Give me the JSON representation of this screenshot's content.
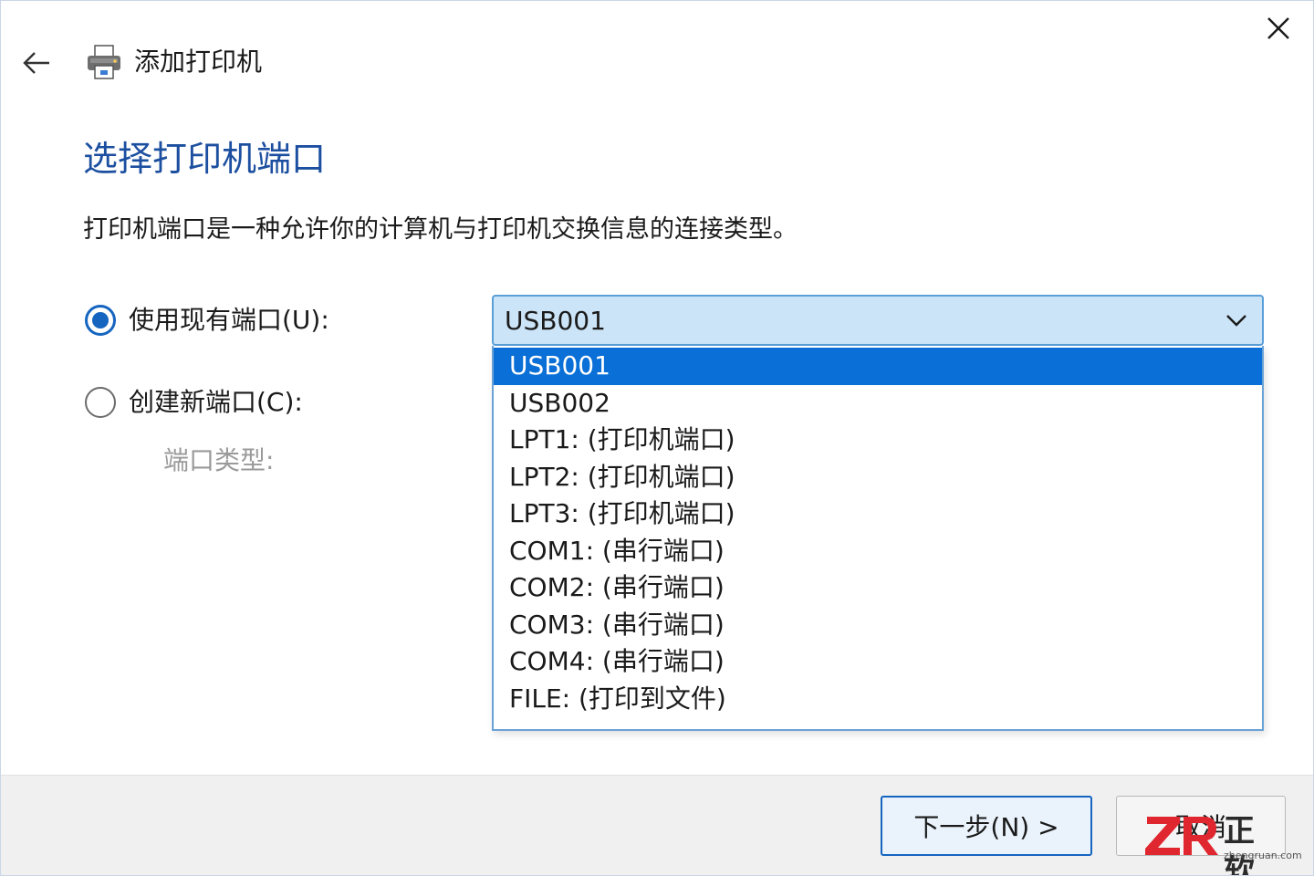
{
  "window": {
    "title": "添加打印机",
    "close_icon": "close-icon",
    "back_icon": "back-arrow-icon",
    "app_icon": "printer-icon"
  },
  "page": {
    "heading": "选择打印机端口",
    "description": "打印机端口是一种允许你的计算机与打印机交换信息的连接类型。"
  },
  "options": {
    "use_existing": {
      "label": "使用现有端口(U):",
      "checked": true
    },
    "create_new": {
      "label": "创建新端口(C):",
      "checked": false
    },
    "port_type_label": "端口类型:"
  },
  "port_combo": {
    "value": "USB001",
    "expanded": true,
    "chevron_icon": "chevron-down-icon",
    "items": [
      {
        "label": "USB001",
        "selected": true
      },
      {
        "label": "USB002",
        "selected": false
      },
      {
        "label": "LPT1:  (打印机端口)",
        "selected": false
      },
      {
        "label": "LPT2:  (打印机端口)",
        "selected": false
      },
      {
        "label": "LPT3:  (打印机端口)",
        "selected": false
      },
      {
        "label": "COM1:  (串行端口)",
        "selected": false
      },
      {
        "label": "COM2:  (串行端口)",
        "selected": false
      },
      {
        "label": "COM3:  (串行端口)",
        "selected": false
      },
      {
        "label": "COM4:  (串行端口)",
        "selected": false
      },
      {
        "label": "FILE:  (打印到文件)",
        "selected": false
      }
    ]
  },
  "footer": {
    "next_label": "下一步(N) >",
    "cancel_label": "取消"
  },
  "watermark": {
    "logo_letters": "ZR",
    "brand": "正 软",
    "url": "zhengruan.com"
  },
  "colors": {
    "heading": "#1c4fa0",
    "accent": "#1565c0",
    "selected_item_bg": "#0a6fd6",
    "combo_bg": "#cce4f7",
    "footer_bg": "#f0f0f0",
    "watermark_red": "#e0262f"
  }
}
